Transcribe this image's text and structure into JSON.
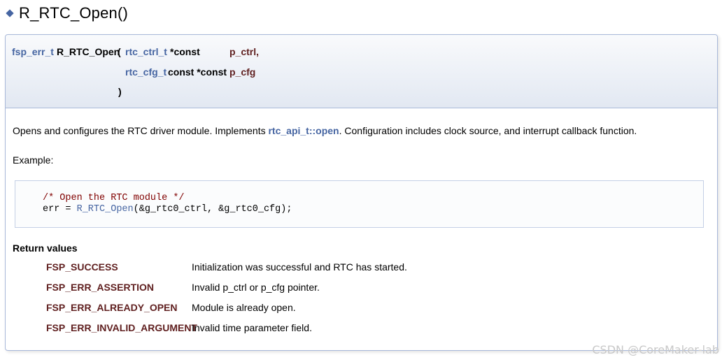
{
  "title": "R_RTC_Open()",
  "prototype": {
    "return_type": "fsp_err_t",
    "func_name": "R_RTC_Open",
    "open_paren": "(",
    "param1_type": "rtc_ctrl_t",
    "param1_qual": "*const",
    "param1_name": "p_ctrl,",
    "param2_type": "rtc_cfg_t",
    "param2_qual": "const *const",
    "param2_name": "p_cfg",
    "close_paren": ")"
  },
  "description": {
    "before": "Opens and configures the RTC driver module. Implements ",
    "link": "rtc_api_t::open",
    "after": ". Configuration includes clock source, and interrupt callback function."
  },
  "example_label": "Example:",
  "code": {
    "comment": "/* Open the RTC module */",
    "line2_prefix": "err = ",
    "line2_func": "R_RTC_Open",
    "line2_suffix": "(&g_rtc0_ctrl, &g_rtc0_cfg);"
  },
  "return_values": {
    "title": "Return values",
    "items": [
      {
        "name": "FSP_SUCCESS",
        "desc": "Initialization was successful and RTC has started."
      },
      {
        "name": "FSP_ERR_ASSERTION",
        "desc": "Invalid p_ctrl or p_cfg pointer."
      },
      {
        "name": "FSP_ERR_ALREADY_OPEN",
        "desc": "Module is already open."
      },
      {
        "name": "FSP_ERR_INVALID_ARGUMENT",
        "desc": "Invalid time parameter field."
      }
    ]
  },
  "watermark": "CSDN @CoreMaker-lab",
  "colors": {
    "link": "#4665a2",
    "param": "#602020",
    "comment": "#800000",
    "border": "#a8b8d9"
  }
}
